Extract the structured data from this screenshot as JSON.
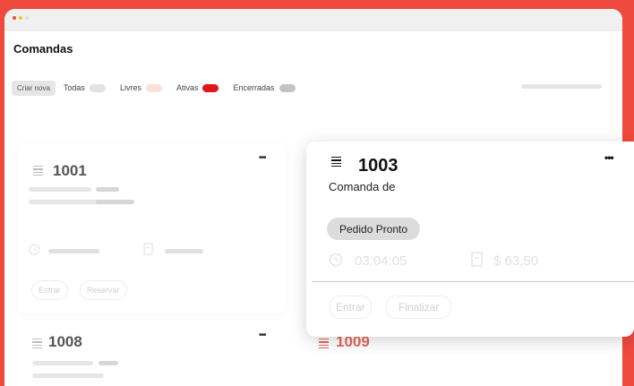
{
  "window": {
    "title": ""
  },
  "header": {
    "title": "Comandas"
  },
  "filters": {
    "create_label": "Criar nova",
    "items": [
      {
        "label": "Todas",
        "color": "#e3e3e3"
      },
      {
        "label": "Livres",
        "color": "#fbe1da"
      },
      {
        "label": "Ativas",
        "color": "#e0161b"
      },
      {
        "label": "Encerradas",
        "color": "#c3c3c3"
      }
    ]
  },
  "cards": [
    {
      "number": "1001",
      "more_icon": "•••",
      "enter_label": "Entrar",
      "reserve_label": "Reservar"
    },
    {
      "number": "1003",
      "subtitle": "Comanda de",
      "more_icon": "•••",
      "status": "Pedido Pronto",
      "time": "03:04:05",
      "total": "$ 63,50",
      "enter_label": "Entrar",
      "finish_label": "Finalizar"
    },
    {
      "number": "1008",
      "more_icon": "•••"
    },
    {
      "number": "1009",
      "more_icon": "•••",
      "accent": "#e36a5c"
    }
  ],
  "icons": [
    "list-icon",
    "more-icon",
    "clock-icon",
    "receipt-icon"
  ]
}
